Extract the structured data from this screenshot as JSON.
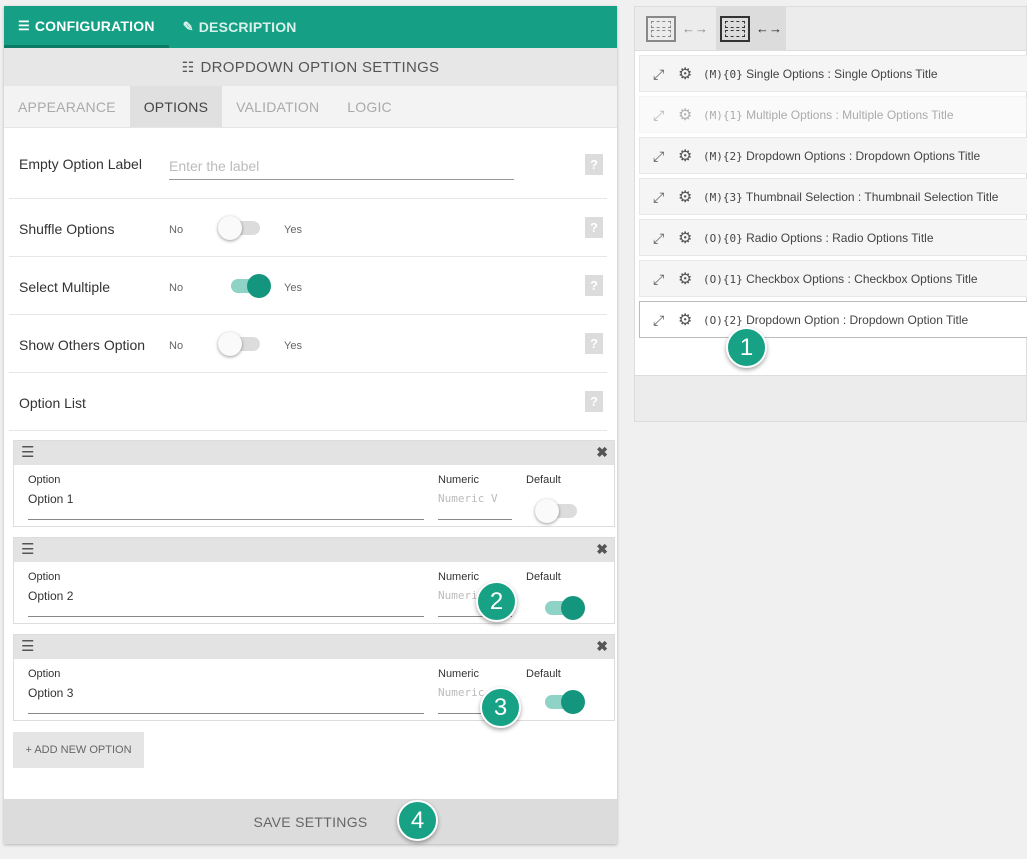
{
  "top_tabs": [
    {
      "label": "CONFIGURATION",
      "icon": "list-icon"
    },
    {
      "label": "DESCRIPTION",
      "icon": "feather-icon"
    }
  ],
  "section_title": "DROPDOWN OPTION SETTINGS",
  "sub_tabs": [
    "APPEARANCE",
    "OPTIONS",
    "VALIDATION",
    "LOGIC"
  ],
  "settings": {
    "empty_option_label": {
      "label": "Empty Option Label",
      "placeholder": "Enter the label"
    },
    "shuffle_options": {
      "label": "Shuffle Options",
      "no": "No",
      "yes": "Yes",
      "value": false
    },
    "select_multiple": {
      "label": "Select Multiple",
      "no": "No",
      "yes": "Yes",
      "value": true
    },
    "show_others_option": {
      "label": "Show Others Option",
      "no": "No",
      "yes": "Yes",
      "value": false
    },
    "option_list": {
      "label": "Option List"
    }
  },
  "option_columns": {
    "option": "Option",
    "numeric": "Numeric",
    "default": "Default"
  },
  "options": [
    {
      "value": "Option 1",
      "numeric_placeholder": "Numeric V",
      "default": false
    },
    {
      "value": "Option 2",
      "numeric_placeholder": "Numeric",
      "default": true
    },
    {
      "value": "Option 3",
      "numeric_placeholder": "Numeric",
      "default": true
    }
  ],
  "add_option_label": "+ ADD NEW OPTION",
  "save_label": "SAVE SETTINGS",
  "form_items": [
    {
      "code": "(M){0}",
      "text": "Single Options : Single Options Title",
      "state": "normal"
    },
    {
      "code": "(M){1}",
      "text": "Multiple Options : Multiple Options Title",
      "state": "disabled"
    },
    {
      "code": "(M){2}",
      "text": "Dropdown Options : Dropdown Options Title",
      "state": "normal"
    },
    {
      "code": "(M){3}",
      "text": "Thumbnail Selection : Thumbnail Selection Title",
      "state": "normal"
    },
    {
      "code": "(O){0}",
      "text": "Radio Options : Radio Options Title",
      "state": "normal"
    },
    {
      "code": "(O){1}",
      "text": "Checkbox Options : Checkbox Options Title",
      "state": "normal"
    },
    {
      "code": "(O){2}",
      "text": "Dropdown Option : Dropdown Option Title",
      "state": "selected"
    }
  ],
  "badges": [
    "1",
    "2",
    "3",
    "4"
  ],
  "colors": {
    "accent": "#15a085",
    "toggle_on": "#14967e",
    "toggle_track_on": "#8fd3c6"
  }
}
